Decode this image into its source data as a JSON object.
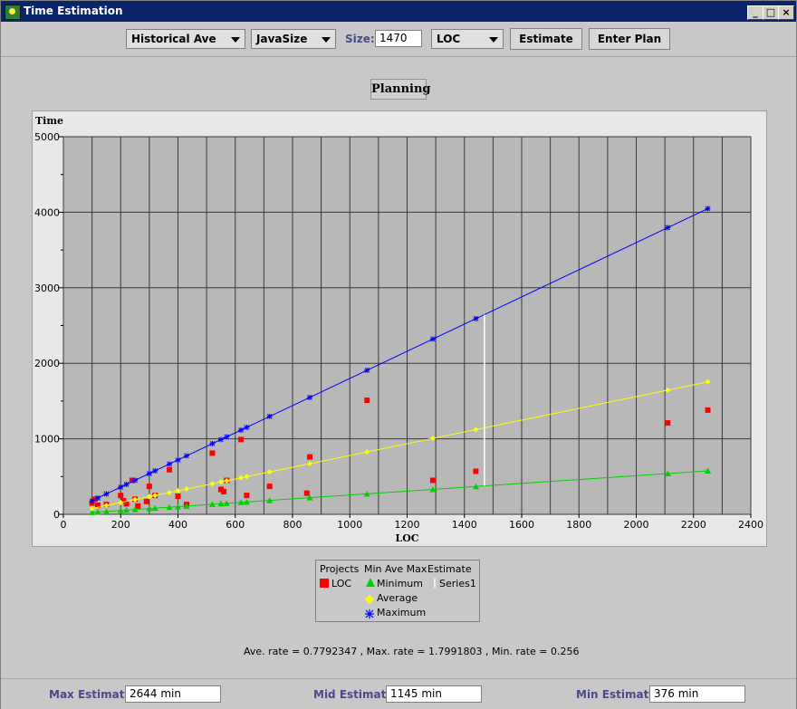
{
  "window": {
    "title": "Time Estimation",
    "minimize_glyph": "_",
    "maximize_glyph": "□",
    "close_glyph": "×"
  },
  "toolbar": {
    "method_select": "Historical Ave",
    "type_select": "JavaSize",
    "size_label": "Size:",
    "size_value": "1470",
    "unit_select": "LOC",
    "estimate_button": "Estimate",
    "enter_plan_button": "Enter Plan"
  },
  "planning_title": "Planning",
  "legend": {
    "projects_header": "Projects",
    "mmm_header": "Min Ave Max",
    "estimate_header": "Estimate",
    "loc_label": "LOC",
    "minimum_label": "Minimum",
    "average_label": "Average",
    "maximum_label": "Maximum",
    "series1_label": "Series1"
  },
  "rates_text": "Ave. rate = 0.7792347 ,  Max. rate = 1.7991803 ,  Min. rate = 0.256",
  "bottom": {
    "max_label": "Max Estimate:",
    "max_value": "2644 min",
    "mid_label": "Mid Estimate:",
    "mid_value": "1145 min",
    "min_label": "Min Estimate:",
    "min_value": "376 min"
  },
  "colors": {
    "loc": "#ff0000",
    "minimum": "#00d000",
    "average": "#ffff00",
    "maximum": "#0000ff",
    "series1": "#ffffff",
    "plot_bg": "#b8b8b8"
  },
  "chart_data": {
    "type": "scatter",
    "ylabel": "Time",
    "xlabel": "LOC",
    "xlim": [
      0,
      2400
    ],
    "ylim": [
      0,
      5000
    ],
    "x_ticks": [
      "0",
      "200",
      "400",
      "600",
      "800",
      "1000",
      "1200",
      "1400",
      "1600",
      "1800",
      "2000",
      "2200",
      "2400"
    ],
    "y_ticks": [
      "0",
      "1000",
      "2000",
      "3000",
      "4000",
      "5000"
    ],
    "grid": true,
    "series": [
      {
        "name": "LOC",
        "marker": "square",
        "points": [
          [
            100,
            150
          ],
          [
            110,
            200
          ],
          [
            120,
            120
          ],
          [
            150,
            130
          ],
          [
            200,
            250
          ],
          [
            210,
            180
          ],
          [
            220,
            140
          ],
          [
            240,
            450
          ],
          [
            250,
            200
          ],
          [
            260,
            110
          ],
          [
            290,
            170
          ],
          [
            300,
            370
          ],
          [
            320,
            250
          ],
          [
            370,
            590
          ],
          [
            400,
            240
          ],
          [
            430,
            130
          ],
          [
            520,
            810
          ],
          [
            550,
            330
          ],
          [
            560,
            300
          ],
          [
            570,
            450
          ],
          [
            620,
            990
          ],
          [
            640,
            250
          ],
          [
            720,
            370
          ],
          [
            850,
            280
          ],
          [
            860,
            760
          ],
          [
            1060,
            1510
          ],
          [
            1290,
            450
          ],
          [
            1440,
            570
          ],
          [
            2110,
            1210
          ],
          [
            2250,
            1380
          ]
        ]
      },
      {
        "name": "Minimum",
        "marker": "triangle",
        "points": [
          [
            100,
            26
          ],
          [
            120,
            31
          ],
          [
            150,
            38
          ],
          [
            200,
            51
          ],
          [
            220,
            56
          ],
          [
            250,
            64
          ],
          [
            300,
            77
          ],
          [
            320,
            82
          ],
          [
            370,
            95
          ],
          [
            400,
            102
          ],
          [
            430,
            110
          ],
          [
            520,
            133
          ],
          [
            550,
            141
          ],
          [
            570,
            146
          ],
          [
            620,
            159
          ],
          [
            640,
            164
          ],
          [
            720,
            184
          ],
          [
            860,
            220
          ],
          [
            1060,
            271
          ],
          [
            1290,
            330
          ],
          [
            1440,
            369
          ],
          [
            2110,
            540
          ],
          [
            2250,
            576
          ]
        ]
      },
      {
        "name": "Average",
        "marker": "diamond",
        "points": [
          [
            100,
            78
          ],
          [
            150,
            117
          ],
          [
            200,
            156
          ],
          [
            250,
            195
          ],
          [
            300,
            234
          ],
          [
            320,
            249
          ],
          [
            370,
            288
          ],
          [
            400,
            312
          ],
          [
            430,
            335
          ],
          [
            520,
            405
          ],
          [
            550,
            429
          ],
          [
            570,
            444
          ],
          [
            620,
            483
          ],
          [
            640,
            499
          ],
          [
            720,
            561
          ],
          [
            860,
            670
          ],
          [
            1060,
            826
          ],
          [
            1290,
            1005
          ],
          [
            1440,
            1122
          ],
          [
            2110,
            1644
          ],
          [
            2250,
            1753
          ]
        ]
      },
      {
        "name": "Maximum",
        "marker": "asterisk",
        "points": [
          [
            100,
            180
          ],
          [
            120,
            216
          ],
          [
            150,
            270
          ],
          [
            200,
            360
          ],
          [
            220,
            396
          ],
          [
            250,
            450
          ],
          [
            300,
            540
          ],
          [
            320,
            576
          ],
          [
            370,
            666
          ],
          [
            400,
            720
          ],
          [
            430,
            774
          ],
          [
            520,
            936
          ],
          [
            550,
            990
          ],
          [
            570,
            1026
          ],
          [
            620,
            1116
          ],
          [
            640,
            1152
          ],
          [
            720,
            1296
          ],
          [
            860,
            1547
          ],
          [
            1060,
            1907
          ],
          [
            1290,
            2321
          ],
          [
            1440,
            2591
          ],
          [
            2110,
            3796
          ],
          [
            2250,
            4048
          ]
        ]
      },
      {
        "name": "Series1",
        "marker": "none",
        "points": [
          [
            1470,
            376
          ],
          [
            1470,
            2644
          ]
        ]
      }
    ]
  }
}
